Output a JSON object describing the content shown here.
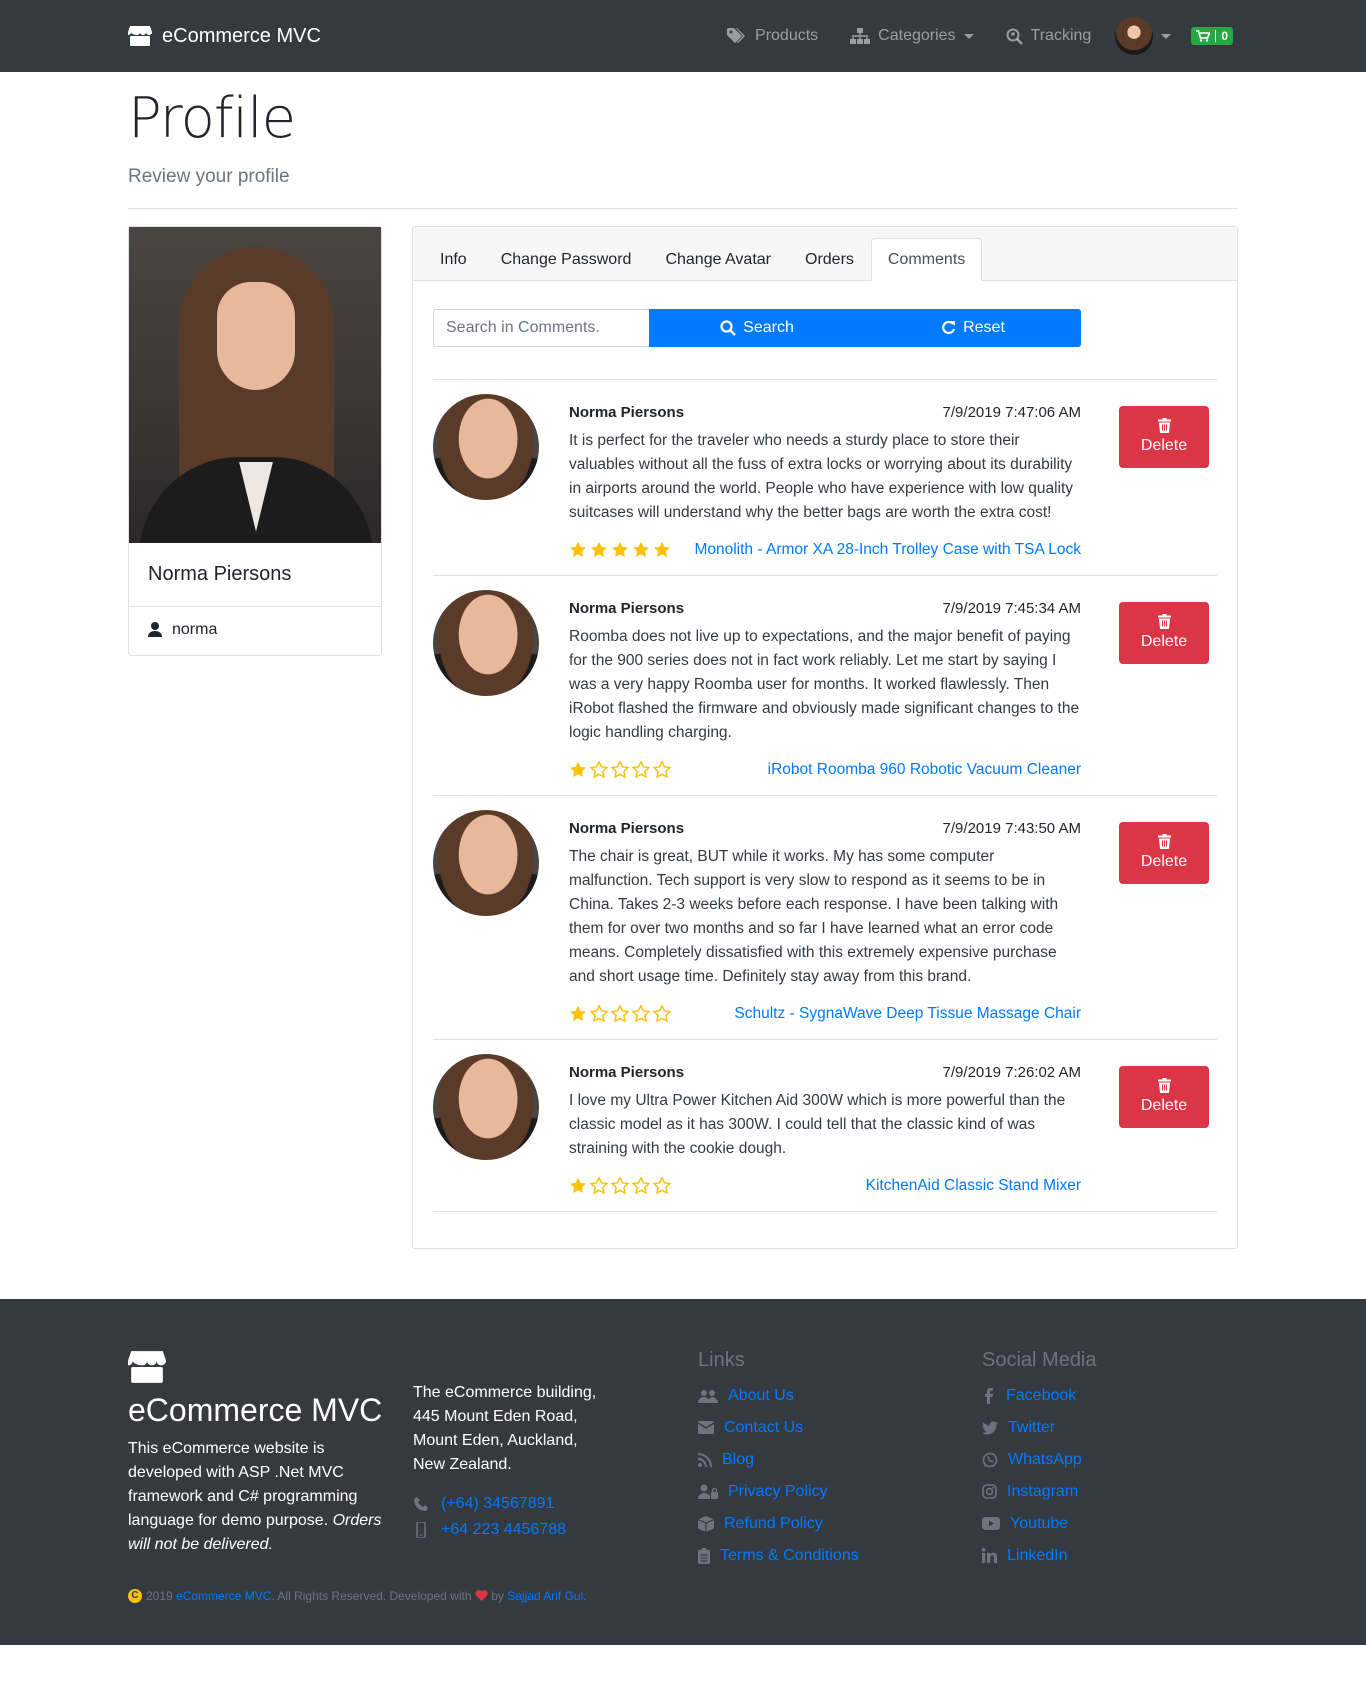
{
  "nav": {
    "brand": "eCommerce MVC",
    "products": "Products",
    "categories": "Categories",
    "tracking": "Tracking",
    "cart_count": "0"
  },
  "header": {
    "title": "Profile",
    "subtitle": "Review your profile"
  },
  "profile": {
    "name": "Norma Piersons",
    "username": "norma"
  },
  "tabs": [
    "Info",
    "Change Password",
    "Change Avatar",
    "Orders",
    "Comments"
  ],
  "search": {
    "placeholder": "Search in Comments.",
    "search_label": "Search",
    "reset_label": "Reset"
  },
  "comments": [
    {
      "author": "Norma Piersons",
      "date": "7/9/2019 7:47:06 AM",
      "text": "It is perfect for the traveler who needs a sturdy place to store their valuables without all the fuss of extra locks or worrying about its durability in airports around the world. People who have experience with low quality suitcases will understand why the better bags are worth the extra cost!",
      "rating": 5,
      "product": "Monolith - Armor XA 28-Inch Trolley Case with TSA Lock",
      "delete_label": "Delete"
    },
    {
      "author": "Norma Piersons",
      "date": "7/9/2019 7:45:34 AM",
      "text": "Roomba does not live up to expectations, and the major benefit of paying for the 900 series does not in fact work reliably. Let me start by saying I was a very happy Roomba user for months. It worked flawlessly. Then iRobot flashed the firmware and obviously made significant changes to the logic handling charging.",
      "rating": 1,
      "product": "iRobot Roomba 960 Robotic Vacuum Cleaner",
      "delete_label": "Delete"
    },
    {
      "author": "Norma Piersons",
      "date": "7/9/2019 7:43:50 AM",
      "text": "The chair is great, BUT while it works. My has some computer malfunction. Tech support is very slow to respond as it seems to be in China. Takes 2-3 weeks before each response. I have been talking with them for over two months and so far I have learned what an error code means. Completely dissatisfied with this extremely expensive purchase and short usage time. Definitely stay away from this brand.",
      "rating": 1,
      "product": "Schultz - SygnaWave Deep Tissue Massage Chair",
      "delete_label": "Delete"
    },
    {
      "author": "Norma Piersons",
      "date": "7/9/2019 7:26:02 AM",
      "text": "I love my Ultra Power Kitchen Aid 300W which is more powerful than the classic model as it has 300W. I could tell that the classic kind of was straining with the cookie dough.",
      "rating": 1,
      "product": "KitchenAid Classic Stand Mixer",
      "delete_label": "Delete"
    }
  ],
  "footer": {
    "brand": "eCommerce MVC",
    "desc_plain": "This eCommerce website is developed with ASP .Net MVC framework and C# programming language for demo purpose.",
    "desc_em": "Orders will not be delivered.",
    "address": [
      "The eCommerce building,",
      "445 Mount Eden Road,",
      "Mount Eden, Auckland,",
      "New Zealand."
    ],
    "phone": "(+64) 34567891",
    "mobile": "+64 223 4456788",
    "links_heading": "Links",
    "links": [
      "About Us",
      "Contact Us",
      "Blog",
      "Privacy Policy",
      "Refund Policy",
      "Terms & Conditions"
    ],
    "social_heading": "Social Media",
    "social": [
      "Facebook",
      "Twitter",
      "WhatsApp",
      "Instagram",
      "Youtube",
      "LinkedIn"
    ],
    "copyright_symbol": "C",
    "copy_year": "2019",
    "copy_brand": "eCommerce MVC",
    "copy_rights": ". All Rights Reserved. Developed with",
    "copy_by": "by",
    "copy_author": "Sajjad Arif Gul",
    "copy_end": "."
  },
  "colors": {
    "navbar": "#343a40",
    "primary": "#007bff",
    "danger": "#dc3545",
    "success": "#28a745",
    "star": "#ffc107"
  }
}
